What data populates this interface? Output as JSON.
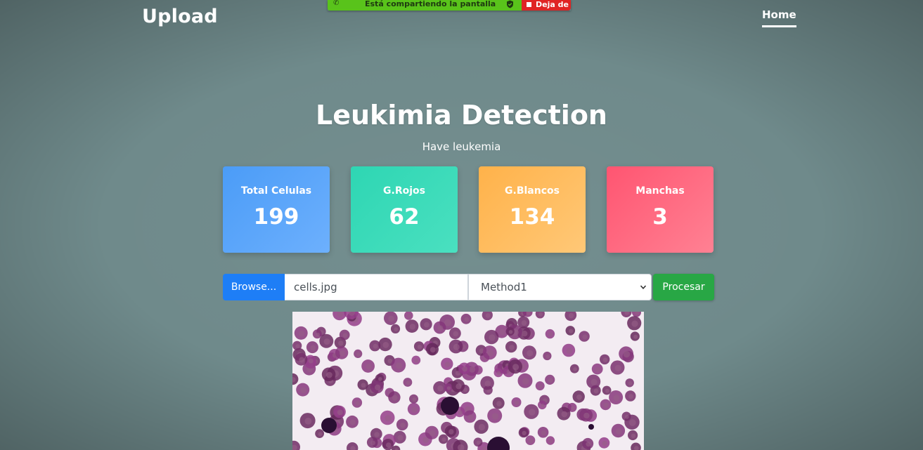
{
  "navbar": {
    "brand": "Upload",
    "home_label": "Home"
  },
  "screen_share": {
    "message": "Está compartiendo la pantalla",
    "stop_label": "Deja de"
  },
  "header": {
    "title": "Leukimia Detection",
    "subtitle": "Have leukemia"
  },
  "stats": [
    {
      "label": "Total Celulas",
      "value": "199"
    },
    {
      "label": "G.Rojos",
      "value": "62"
    },
    {
      "label": "G.Blancos",
      "value": "134"
    },
    {
      "label": "Manchas",
      "value": "3"
    }
  ],
  "upload_form": {
    "browse_label": "Browse...",
    "file_name": "cells.jpg",
    "method_selected": "Method1",
    "process_label": "Procesar"
  },
  "colors": {
    "background": "#6f8a8b",
    "browse_button": "#1e7ef6",
    "process_button": "#28a745",
    "share_bar": "#59c31b",
    "share_stop": "#e02424"
  }
}
